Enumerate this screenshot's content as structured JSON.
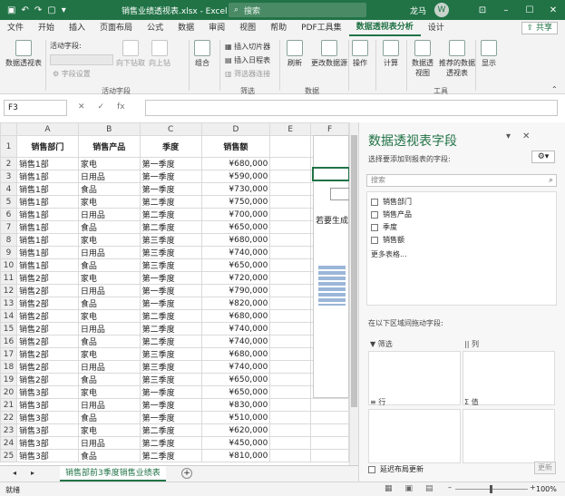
{
  "app": {
    "title": "销售业绩透视表.xlsx - Excel",
    "search_placeholder": "搜索",
    "user_name": "龙马",
    "avatar_initial": "W",
    "share_label": "共享"
  },
  "menu_tabs": [
    "文件",
    "开始",
    "插入",
    "页面布局",
    "公式",
    "数据",
    "审阅",
    "视图",
    "帮助",
    "PDF工具集",
    "数据透视表分析",
    "设计"
  ],
  "active_tab_index": 10,
  "ribbon": {
    "pivot_table_label": "数据透视表",
    "active_field_label": "活动字段:",
    "field_settings": "字段设置",
    "drill_down": "向下钻取",
    "drill_up": "向上钻",
    "group_active_field": "活动字段",
    "group_label": "组合",
    "insert_slicer": "插入切片器",
    "insert_timeline": "插入日程表",
    "filter_connections": "筛选器连接",
    "group_filter": "筛选",
    "refresh": "刷新",
    "change_source": "更改数据源",
    "group_data": "数据",
    "actions": "操作",
    "calculations": "计算",
    "pivot_chart": "数据透视图",
    "recommended_pivot": "推荐的数据透视表",
    "group_tools": "工具",
    "show": "显示"
  },
  "formula_bar": {
    "name_box": "F3",
    "fx": "fx",
    "value": ""
  },
  "grid": {
    "col_headers": [
      "A",
      "B",
      "C",
      "D",
      "E",
      "F"
    ],
    "header_row": [
      "销售部门",
      "销售产品",
      "季度",
      "销售额"
    ],
    "rows": [
      [
        "销售1部",
        "家电",
        "第一季度",
        "¥680,000"
      ],
      [
        "销售1部",
        "日用品",
        "第一季度",
        "¥590,000"
      ],
      [
        "销售1部",
        "食品",
        "第一季度",
        "¥730,000"
      ],
      [
        "销售1部",
        "家电",
        "第二季度",
        "¥750,000"
      ],
      [
        "销售1部",
        "日用品",
        "第二季度",
        "¥700,000"
      ],
      [
        "销售1部",
        "食品",
        "第二季度",
        "¥650,000"
      ],
      [
        "销售1部",
        "家电",
        "第三季度",
        "¥680,000"
      ],
      [
        "销售1部",
        "日用品",
        "第三季度",
        "¥740,000"
      ],
      [
        "销售1部",
        "食品",
        "第三季度",
        "¥650,000"
      ],
      [
        "销售2部",
        "家电",
        "第一季度",
        "¥720,000"
      ],
      [
        "销售2部",
        "日用品",
        "第一季度",
        "¥790,000"
      ],
      [
        "销售2部",
        "食品",
        "第一季度",
        "¥820,000"
      ],
      [
        "销售2部",
        "家电",
        "第二季度",
        "¥680,000"
      ],
      [
        "销售2部",
        "日用品",
        "第二季度",
        "¥740,000"
      ],
      [
        "销售2部",
        "食品",
        "第二季度",
        "¥740,000"
      ],
      [
        "销售2部",
        "家电",
        "第三季度",
        "¥680,000"
      ],
      [
        "销售2部",
        "日用品",
        "第三季度",
        "¥740,000"
      ],
      [
        "销售2部",
        "食品",
        "第三季度",
        "¥650,000"
      ],
      [
        "销售3部",
        "家电",
        "第一季度",
        "¥650,000"
      ],
      [
        "销售3部",
        "日用品",
        "第一季度",
        "¥830,000"
      ],
      [
        "销售3部",
        "食品",
        "第一季度",
        "¥510,000"
      ],
      [
        "销售3部",
        "家电",
        "第二季度",
        "¥620,000"
      ],
      [
        "销售3部",
        "日用品",
        "第二季度",
        "¥450,000"
      ],
      [
        "销售3部",
        "食品",
        "第二季度",
        "¥810,000"
      ]
    ],
    "pivot_placeholder_text": "若要生成"
  },
  "sheet_tab": "销售部前3季度销售业绩表",
  "pivot_pane": {
    "title": "数据透视表字段",
    "subtitle": "选择要添加到报表的字段:",
    "search_placeholder": "搜索",
    "fields": [
      "销售部门",
      "销售产品",
      "季度",
      "销售额"
    ],
    "more_tables": "更多表格...",
    "drag_hint": "在以下区域间拖动字段:",
    "area_filter": "筛选",
    "area_columns": "列",
    "area_rows": "行",
    "area_values": "值",
    "defer_update": "延迟布局更新",
    "update_button": "更新"
  },
  "status": {
    "ready": "就绪",
    "zoom": "100%",
    "zoom_level_percent": 100
  }
}
